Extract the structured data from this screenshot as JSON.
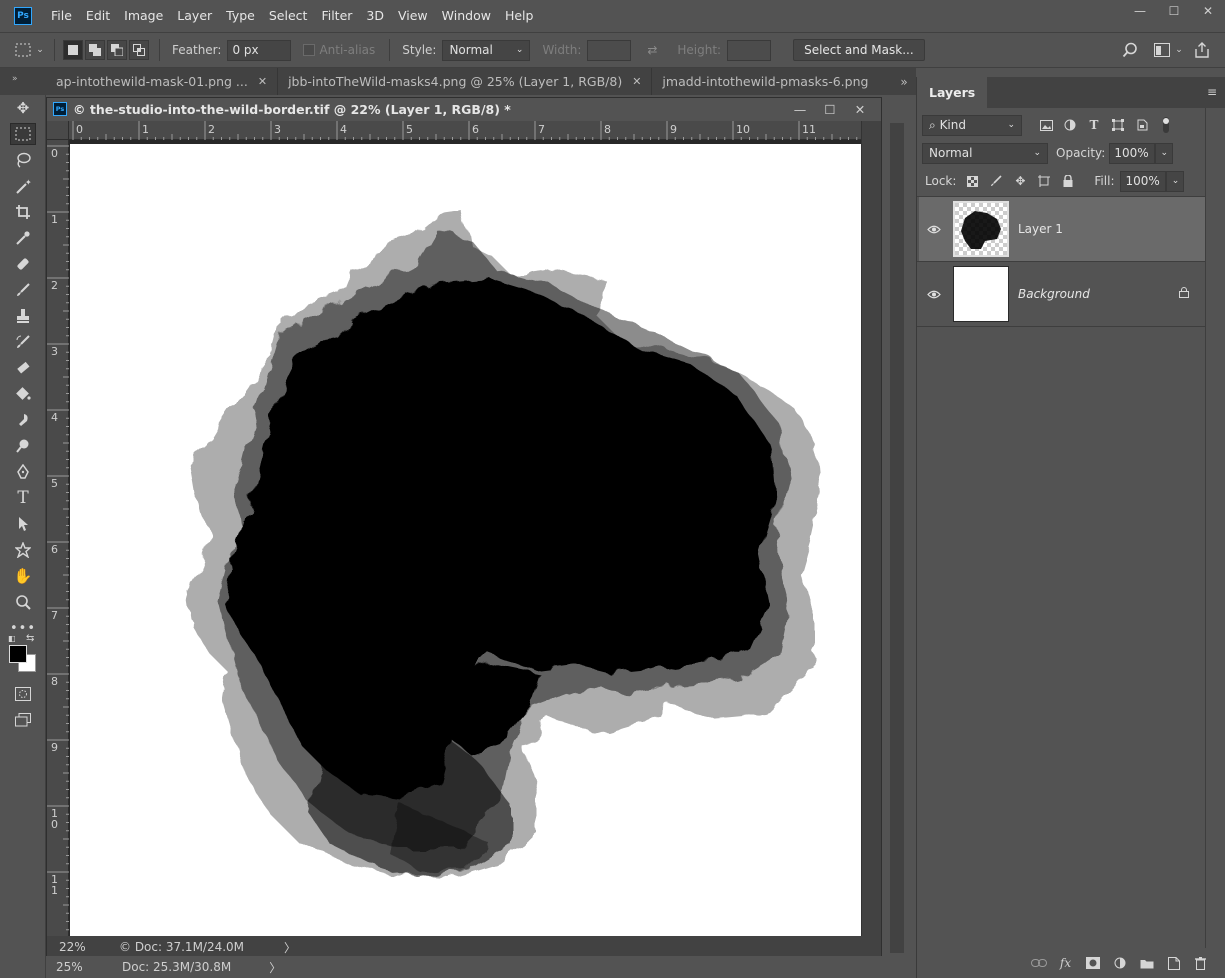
{
  "app": {
    "logo_text": "Ps"
  },
  "menu": [
    "File",
    "Edit",
    "Image",
    "Layer",
    "Type",
    "Select",
    "Filter",
    "3D",
    "View",
    "Window",
    "Help"
  ],
  "window_controls": {
    "minimize": "—",
    "maximize": "☐",
    "close": "✕"
  },
  "options": {
    "feather_label": "Feather:",
    "feather_value": "0 px",
    "antialias_label": "Anti-alias",
    "style_label": "Style:",
    "style_value": "Normal",
    "width_label": "Width:",
    "height_label": "Height:",
    "select_mask_label": "Select and Mask..."
  },
  "doc_tabs": [
    {
      "label": "ap-intothewild-mask-01.png ..."
    },
    {
      "label": "jbb-intoTheWild-masks4.png @ 25% (Layer 1, RGB/8)"
    },
    {
      "label": "jmadd-intothewild-pmasks-6.png"
    }
  ],
  "doc_window": {
    "title": "© the-studio-into-the-wild-border.tif @ 22% (Layer 1, RGB/8) *",
    "ps_mini": "Ps",
    "zoom": "22%",
    "doc_info": "© Doc: 37.1M/24.0M",
    "arrow": "〉"
  },
  "ruler": {
    "h": [
      "0",
      "1",
      "2",
      "3",
      "4",
      "5",
      "6",
      "7",
      "8",
      "9",
      "10",
      "11"
    ],
    "v": [
      "0",
      "1",
      "2",
      "3",
      "4",
      "5",
      "6",
      "7",
      "8",
      "9",
      "1\n0",
      "1\n1"
    ]
  },
  "app_status": {
    "zoom": "25%",
    "doc_info": "Doc: 25.3M/30.8M",
    "arrow": "〉"
  },
  "layers": {
    "tab_label": "Layers",
    "menu_icon": "≡",
    "filter_kind": "Kind",
    "blend_mode": "Normal",
    "opacity_label": "Opacity:",
    "opacity_value": "100%",
    "lock_label": "Lock:",
    "fill_label": "Fill:",
    "fill_value": "100%",
    "items": [
      {
        "name": "Layer 1"
      },
      {
        "name": "Background"
      }
    ]
  },
  "colors": {
    "accent": "#31a8ff",
    "canvas": "#ffffff",
    "foreground": "#000000",
    "background": "#ffffff"
  }
}
